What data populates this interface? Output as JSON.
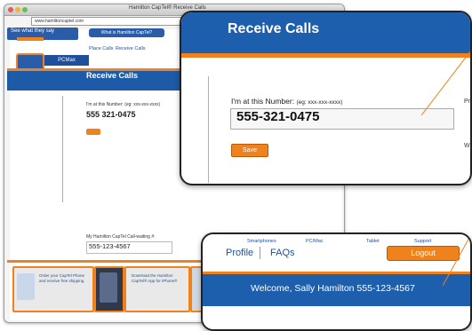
{
  "browser": {
    "title": "Hamilton CapTel® Receive Calls",
    "url": "www.hamiltoncaptel.com"
  },
  "site": {
    "see_what_they_say": "See what they say",
    "top_nav": "What is Hamilton CapTel?",
    "sub_nav": [
      "Place Calls",
      "Receive Calls"
    ],
    "pcmax_label": "PCMax",
    "page_title": "Receive Calls",
    "number_label": "I'm at this Number: (eg: xxx-xxx-xxxx)",
    "number_value": "555 321-0475",
    "callwaiting_label": "My Hamilton CapTel Call-waiting #:",
    "callwaiting_value": "555-123-4567",
    "promos": [
      {
        "text": "Order your CapTel Phone and receive free shipping."
      },
      {
        "text": ""
      },
      {
        "text": "Download the Hamilton CapTel® App for iPhone®"
      },
      {
        "text": ""
      }
    ]
  },
  "card_receive": {
    "title": "Receive Calls",
    "number_label": "I'm at this Number:",
    "number_hint": "(eg: xxx-xxx-xxxx)",
    "number_value": "555-321-0475",
    "save_label": "Save",
    "side_text_1": "Provide the aud will be number",
    "side_text_2": "When y Smartp"
  },
  "card_welcome": {
    "top_nav_items": [
      "Smartphones",
      "PC/Mac",
      "Tablet",
      "Support"
    ],
    "profile_label": "Profile",
    "faqs_label": "FAQs",
    "logout_label": "Logout",
    "welcome_text": "Welcome, Sally Hamilton 555-123-4567"
  },
  "colors": {
    "brand_blue": "#1e5fad",
    "accent_orange": "#f0821e"
  }
}
